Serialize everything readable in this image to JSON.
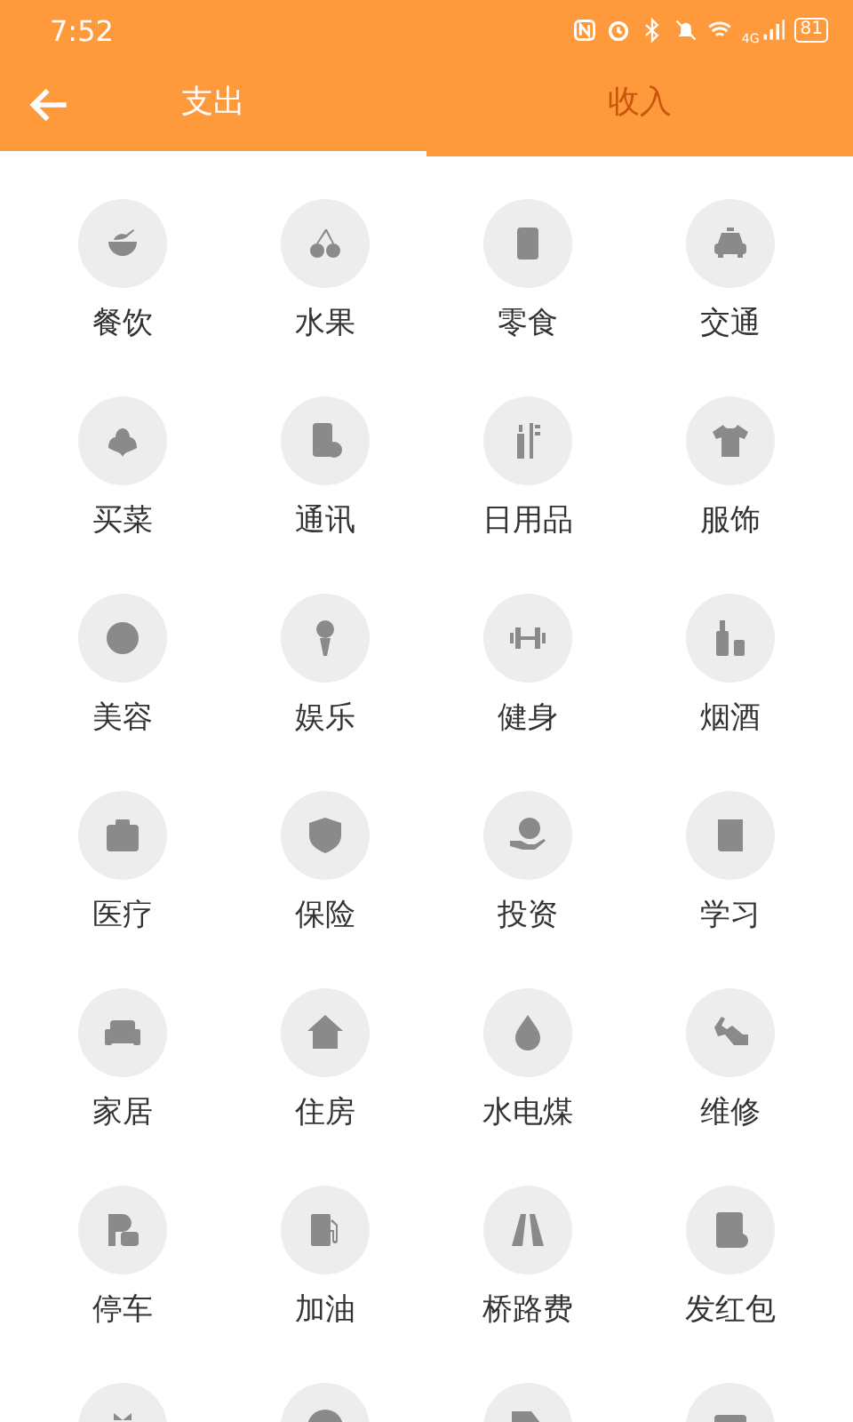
{
  "status_bar": {
    "time": "7:52",
    "network": "4G",
    "battery": "81"
  },
  "tabs": [
    {
      "label": "支出",
      "selected": true
    },
    {
      "label": "收入",
      "selected": false
    }
  ],
  "categories": [
    {
      "kind": "full",
      "label": "餐饮"
    },
    {
      "kind": "full",
      "label": "水果"
    },
    {
      "kind": "full",
      "label": "零食"
    },
    {
      "kind": "full",
      "label": "交通"
    },
    {
      "kind": "full",
      "label": "买菜"
    },
    {
      "kind": "full",
      "label": "通讯"
    },
    {
      "kind": "full",
      "label": "日用品"
    },
    {
      "kind": "full",
      "label": "服饰"
    },
    {
      "kind": "full",
      "label": "美容"
    },
    {
      "kind": "full",
      "label": "娱乐"
    },
    {
      "kind": "full",
      "label": "健身"
    },
    {
      "kind": "full",
      "label": "烟酒"
    },
    {
      "kind": "full",
      "label": "医疗"
    },
    {
      "kind": "full",
      "label": "保险"
    },
    {
      "kind": "full",
      "label": "投资"
    },
    {
      "kind": "full",
      "label": "学习"
    },
    {
      "kind": "full",
      "label": "家居"
    },
    {
      "kind": "full",
      "label": "住房"
    },
    {
      "kind": "full",
      "label": "水电煤"
    },
    {
      "kind": "full",
      "label": "维修"
    },
    {
      "kind": "full",
      "label": "停车"
    },
    {
      "kind": "full",
      "label": "加油"
    },
    {
      "kind": "full",
      "label": "桥路费"
    },
    {
      "kind": "full",
      "label": "发红包"
    },
    {
      "kind": "cut"
    },
    {
      "kind": "cut"
    },
    {
      "kind": "cut"
    },
    {
      "kind": "cut"
    }
  ]
}
